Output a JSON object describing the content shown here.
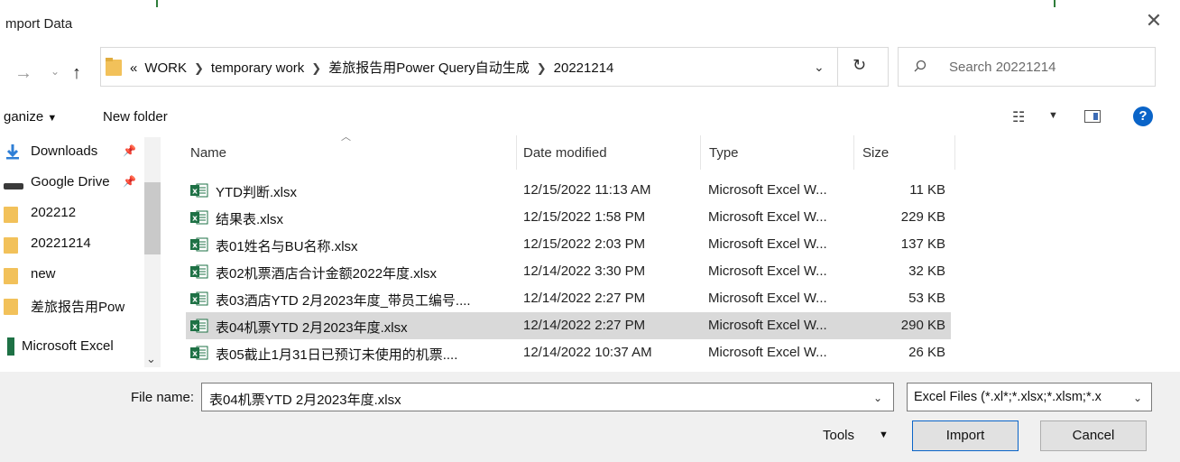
{
  "window": {
    "title": "mport Data"
  },
  "address": {
    "overflow": "«",
    "breadcrumbs": [
      "WORK",
      "temporary work",
      "差旅报告用Power Query自动生成",
      "20221214"
    ]
  },
  "search": {
    "placeholder": "Search 20221214"
  },
  "toolbar": {
    "organize": "ganize",
    "new_folder": "New folder"
  },
  "sidebar": {
    "items": [
      {
        "label": "Downloads",
        "icon": "download-arrow-icon"
      },
      {
        "label": "Google Drive",
        "icon": "drive-icon"
      },
      {
        "label": "202212",
        "icon": "folder-icon"
      },
      {
        "label": "20221214",
        "icon": "folder-icon"
      },
      {
        "label": "new",
        "icon": "folder-icon"
      },
      {
        "label": "差旅报告用Pow",
        "icon": "folder-icon"
      },
      {
        "label": "Microsoft Excel",
        "icon": "excel-icon"
      }
    ]
  },
  "columns": {
    "name": "Name",
    "date": "Date modified",
    "type": "Type",
    "size": "Size"
  },
  "files": [
    {
      "name": "YTD判断.xlsx",
      "date": "12/15/2022 11:13 AM",
      "type": "Microsoft Excel W...",
      "size": "11 KB"
    },
    {
      "name": "结果表.xlsx",
      "date": "12/15/2022 1:58 PM",
      "type": "Microsoft Excel W...",
      "size": "229 KB"
    },
    {
      "name": "表01姓名与BU名称.xlsx",
      "date": "12/15/2022 2:03 PM",
      "type": "Microsoft Excel W...",
      "size": "137 KB"
    },
    {
      "name": "表02机票酒店合计金额2022年度.xlsx",
      "date": "12/14/2022 3:30 PM",
      "type": "Microsoft Excel W...",
      "size": "32 KB"
    },
    {
      "name": "表03酒店YTD 2月2023年度_带员工编号....",
      "date": "12/14/2022 2:27 PM",
      "type": "Microsoft Excel W...",
      "size": "53 KB"
    },
    {
      "name": "表04机票YTD 2月2023年度.xlsx",
      "date": "12/14/2022 2:27 PM",
      "type": "Microsoft Excel W...",
      "size": "290 KB"
    },
    {
      "name": "表05截止1月31日已预订未使用的机票....",
      "date": "12/14/2022 10:37 AM",
      "type": "Microsoft Excel W...",
      "size": "26 KB"
    }
  ],
  "footer": {
    "file_name_label": "File name:",
    "file_name_value": "表04机票YTD 2月2023年度.xlsx",
    "filter": "Excel Files (*.xl*;*.xlsx;*.xlsm;*.x",
    "tools": "Tools",
    "import": "Import",
    "cancel": "Cancel"
  },
  "colors": {
    "accent": "#0a64c8",
    "excel_green": "#1e7145",
    "folder": "#f2c15a",
    "selected_row": "#d9d9d9"
  }
}
